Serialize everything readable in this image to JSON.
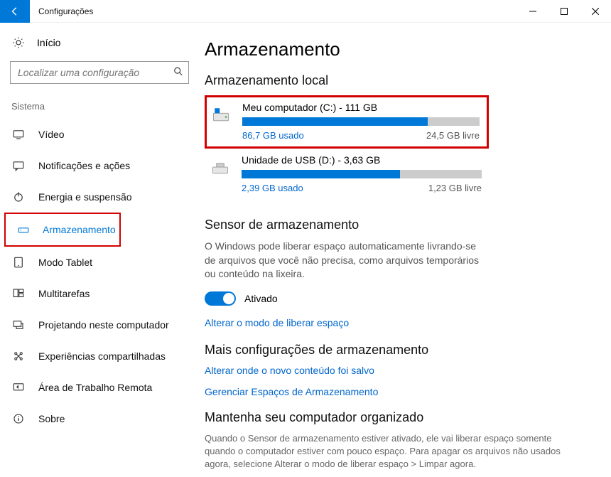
{
  "titlebar": {
    "title": "Configurações"
  },
  "sidebar": {
    "home_label": "Início",
    "search_placeholder": "Localizar uma configuração",
    "group_label": "Sistema",
    "items": [
      {
        "label": "Vídeo",
        "active": false
      },
      {
        "label": "Notificações e ações",
        "active": false
      },
      {
        "label": "Energia e suspensão",
        "active": false
      },
      {
        "label": "Armazenamento",
        "active": true
      },
      {
        "label": "Modo Tablet",
        "active": false
      },
      {
        "label": "Multitarefas",
        "active": false
      },
      {
        "label": "Projetando neste computador",
        "active": false
      },
      {
        "label": "Experiências compartilhadas",
        "active": false
      },
      {
        "label": "Área de Trabalho Remota",
        "active": false
      },
      {
        "label": "Sobre",
        "active": false
      }
    ]
  },
  "page": {
    "title": "Armazenamento",
    "local_heading": "Armazenamento local",
    "drives": [
      {
        "name": "Meu computador (C:) - 111 GB",
        "used": "86,7 GB usado",
        "free": "24,5 GB livre",
        "pct": 78
      },
      {
        "name": "Unidade de USB (D:) - 3,63 GB",
        "used": "2,39 GB usado",
        "free": "1,23 GB livre",
        "pct": 66
      }
    ],
    "sensor": {
      "heading": "Sensor de armazenamento",
      "desc": "O Windows pode liberar espaço automaticamente livrando-se de arquivos que você não precisa, como arquivos temporários ou conteúdo na lixeira.",
      "toggle_label": "Ativado",
      "change_link": "Alterar o modo de liberar espaço"
    },
    "more": {
      "heading": "Mais configurações de armazenamento",
      "link1": "Alterar onde o novo conteúdo foi salvo",
      "link2": "Gerenciar Espaços de Armazenamento"
    },
    "keep": {
      "heading": "Mantenha seu computador organizado",
      "desc": "Quando o Sensor de armazenamento estiver ativado, ele vai liberar espaço somente quando o computador estiver com pouco espaço. Para apagar os arquivos não usados agora, selecione Alterar o modo de liberar espaço > Limpar agora."
    }
  }
}
